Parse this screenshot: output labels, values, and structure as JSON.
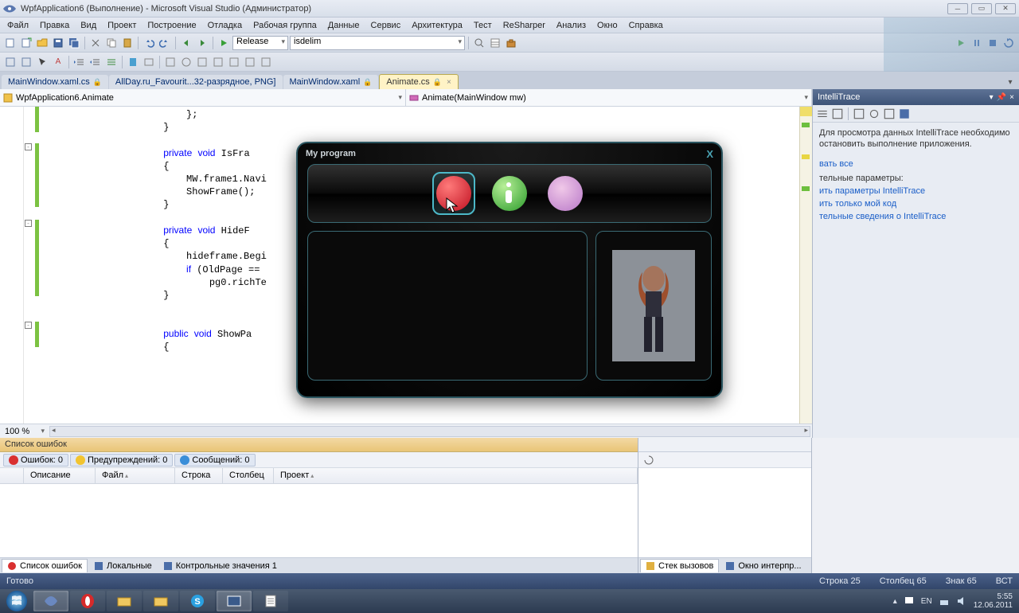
{
  "titlebar": {
    "text": "WpfApplication6 (Выполнение) - Microsoft Visual Studio (Администратор)"
  },
  "menu": [
    "Файл",
    "Правка",
    "Вид",
    "Проект",
    "Построение",
    "Отладка",
    "Рабочая группа",
    "Данные",
    "Сервис",
    "Архитектура",
    "Тест",
    "ReSharper",
    "Анализ",
    "Окно",
    "Справка"
  ],
  "toolbar": {
    "config": "Release",
    "platform": "isdelim"
  },
  "tabs": [
    {
      "label": "MainWindow.xaml.cs",
      "locked": true,
      "active": false
    },
    {
      "label": "AllDay.ru_Favourit...32-разрядное, PNG]",
      "locked": false,
      "active": false
    },
    {
      "label": "MainWindow.xaml",
      "locked": true,
      "active": false
    },
    {
      "label": "Animate.cs",
      "locked": true,
      "active": true
    }
  ],
  "nav": {
    "class": "WpfApplication6.Animate",
    "member": "Animate(MainWindow mw)"
  },
  "code": "                    };\n                }\n\n                private void IsFra\n                {\n                    MW.frame1.Navi\n                    ShowFrame();\n                }\n\n                private void HideF\n                {\n                    hideframe.Begi\n                    if (OldPage ==\n                        pg0.richTe\n                }\n\n\n                public void ShowPa\n                {",
  "zoom": "100 %",
  "errorlist": {
    "title": "Список ошибок",
    "filters": {
      "errors": "Ошибок: 0",
      "warnings": "Предупреждений: 0",
      "messages": "Сообщений: 0"
    },
    "cols": [
      "",
      "Описание",
      "Файл",
      "Строка",
      "Столбец",
      "Проект"
    ]
  },
  "bottomtabs_left": [
    "Список ошибок",
    "Локальные",
    "Контрольные значения 1"
  ],
  "bottomtabs_right": [
    "Стек вызовов",
    "Окно интерпр..."
  ],
  "intellitrace": {
    "title": "IntelliTrace",
    "msg": "Для просмотра данных IntelliTrace необходимо остановить выполнение приложения.",
    "link_break": "вать все",
    "hdr_params": "тельные параметры:",
    "link_params": "ить параметры IntelliTrace",
    "link_mycode": "ить только мой код",
    "link_info": "тельные сведения о IntelliTrace"
  },
  "status": {
    "ready": "Готово",
    "line": "Строка 25",
    "col": "Столбец 65",
    "ch": "Знак 65",
    "ins": "ВСТ"
  },
  "wpf": {
    "title": "My program",
    "close": "X"
  },
  "tray": {
    "lang": "EN",
    "time": "5:55",
    "date": "12.06.2011"
  }
}
